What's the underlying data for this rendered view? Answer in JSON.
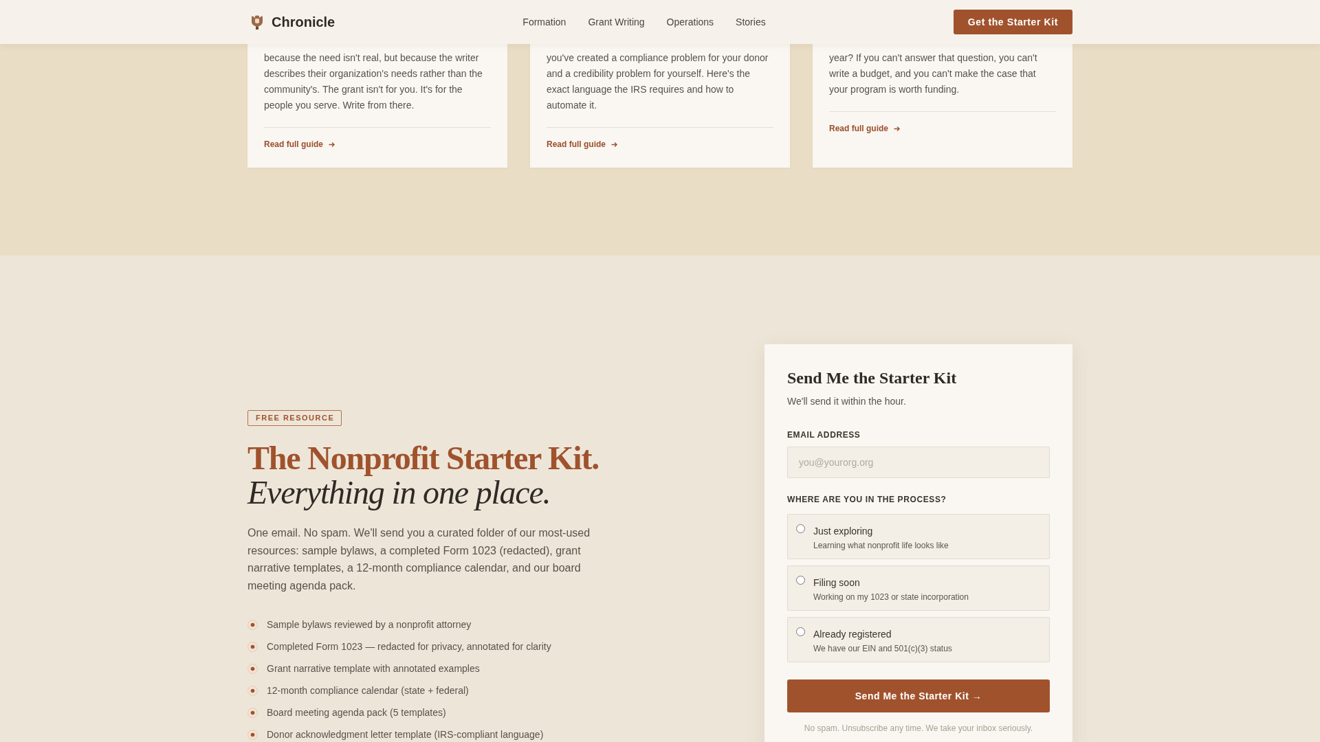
{
  "header": {
    "brand": "Chronicle",
    "nav": [
      "Formation",
      "Grant Writing",
      "Operations",
      "Stories"
    ],
    "cta": "Get the Starter Kit"
  },
  "guides": [
    {
      "excerpt": "because the need isn't real, but because the writer describes their organization's needs rather than the community's. The grant isn't for you. It's for the people you serve. Write from there.",
      "link": "Read full guide"
    },
    {
      "excerpt": "you've created a compliance problem for your donor and a credibility problem for yourself. Here's the exact language the IRS requires and how to automate it.",
      "link": "Read full guide"
    },
    {
      "excerpt": "year? If you can't answer that question, you can't write a budget, and you can't make the case that your program is worth funding.",
      "link": "Read full guide"
    }
  ],
  "starter_kit": {
    "tag": "FREE RESOURCE",
    "title": "The Nonprofit Starter Kit.",
    "tagline": "Everything in one place.",
    "description": "One email. No spam. We'll send you a curated folder of our most-used resources: sample bylaws, a completed Form 1023 (redacted), grant narrative templates, a 12-month compliance calendar, and our board meeting agenda pack.",
    "items": [
      "Sample bylaws reviewed by a nonprofit attorney",
      "Completed Form 1023 — redacted for privacy, annotated for clarity",
      "Grant narrative template with annotated examples",
      "12-month compliance calendar (state + federal)",
      "Board meeting agenda pack (5 templates)",
      "Donor acknowledgment letter template (IRS-compliant language)"
    ]
  },
  "signup": {
    "title": "Send Me the Starter Kit",
    "subtitle": "We'll send it within the hour.",
    "email": {
      "label": "EMAIL ADDRESS",
      "placeholder": "you@yourorg.org"
    },
    "process": {
      "label": "WHERE ARE YOU IN THE PROCESS?",
      "options": [
        {
          "title": "Just exploring",
          "description": "Learning what nonprofit life looks like",
          "selected": false
        },
        {
          "title": "Filing soon",
          "description": "Working on my 1023 or state incorporation",
          "selected": false
        },
        {
          "title": "Already registered",
          "description": "We have our EIN and 501(c)(3) status",
          "selected": false
        }
      ]
    },
    "submit": "Send Me the Starter Kit →",
    "note": "No spam. Unsubscribe any time. We take your inbox seriously."
  }
}
